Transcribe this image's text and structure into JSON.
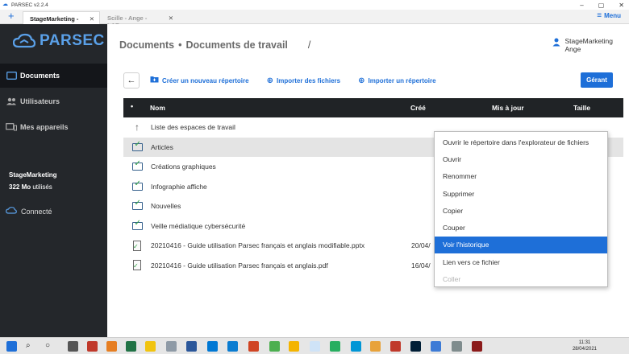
{
  "window": {
    "title": "PARSEC v2.2.4"
  },
  "tabs": [
    {
      "label": "StageMarketing - ...",
      "close": "✕"
    },
    {
      "label": "Scille - Ange - LAP...",
      "close": "✕"
    }
  ],
  "menu": {
    "label": "Menu"
  },
  "sidebar": {
    "logo": "PARSEC",
    "items": [
      {
        "label": "Documents"
      },
      {
        "label": "Utilisateurs"
      },
      {
        "label": "Mes appareils"
      }
    ],
    "org": "StageMarketing",
    "usage_value": "322 Mo",
    "usage_suffix": " utilisés",
    "status": "Connecté"
  },
  "breadcrumb": {
    "root": "Documents",
    "bullet": "•",
    "current": "Documents de travail",
    "slash": "/"
  },
  "user": {
    "org": "StageMarketing",
    "name": "Ange"
  },
  "toolbar": {
    "new_folder": "Créer un nouveau répertoire",
    "import_files": "Importer des fichiers",
    "import_folder": "Importer un répertoire",
    "manage": "Gérant"
  },
  "table": {
    "columns": {
      "name": "Nom",
      "created": "Créé",
      "updated": "Mis à jour",
      "size": "Taille"
    },
    "rows": [
      {
        "name": "Liste des espaces de travail",
        "created": "",
        "icon": "arrow-up-icon"
      },
      {
        "name": "Articles",
        "created": "",
        "icon": "folder-synced-icon"
      },
      {
        "name": "Créations graphiques",
        "created": "",
        "icon": "folder-synced-icon"
      },
      {
        "name": "Infographie affiche",
        "created": "",
        "icon": "folder-synced-icon"
      },
      {
        "name": "Nouvelles",
        "created": "",
        "icon": "folder-synced-icon"
      },
      {
        "name": "Veille médiatique cybersécurité",
        "created": "",
        "icon": "folder-synced-icon"
      },
      {
        "name": "20210416 - Guide utilisation Parsec français et anglais modifiable.pptx",
        "created": "20/04/",
        "icon": "file-synced-icon"
      },
      {
        "name": "20210416 - Guide utilisation Parsec français et anglais.pdf",
        "created": "16/04/",
        "icon": "file-synced-icon"
      }
    ]
  },
  "context_menu": [
    {
      "label": "Ouvrir le répertoire dans l'explorateur de fichiers"
    },
    {
      "label": "Ouvrir"
    },
    {
      "label": "Renommer"
    },
    {
      "label": "Supprimer"
    },
    {
      "label": "Copier"
    },
    {
      "label": "Couper"
    },
    {
      "label": "Voir l'historique"
    },
    {
      "label": "Lien vers ce fichier"
    },
    {
      "label": "Coller"
    }
  ],
  "taskbar": {
    "time": "11:31",
    "date": "28/04/2021"
  },
  "colors": {
    "accent": "#1e6fd8",
    "sidebar": "#24272b",
    "header": "#202326"
  }
}
